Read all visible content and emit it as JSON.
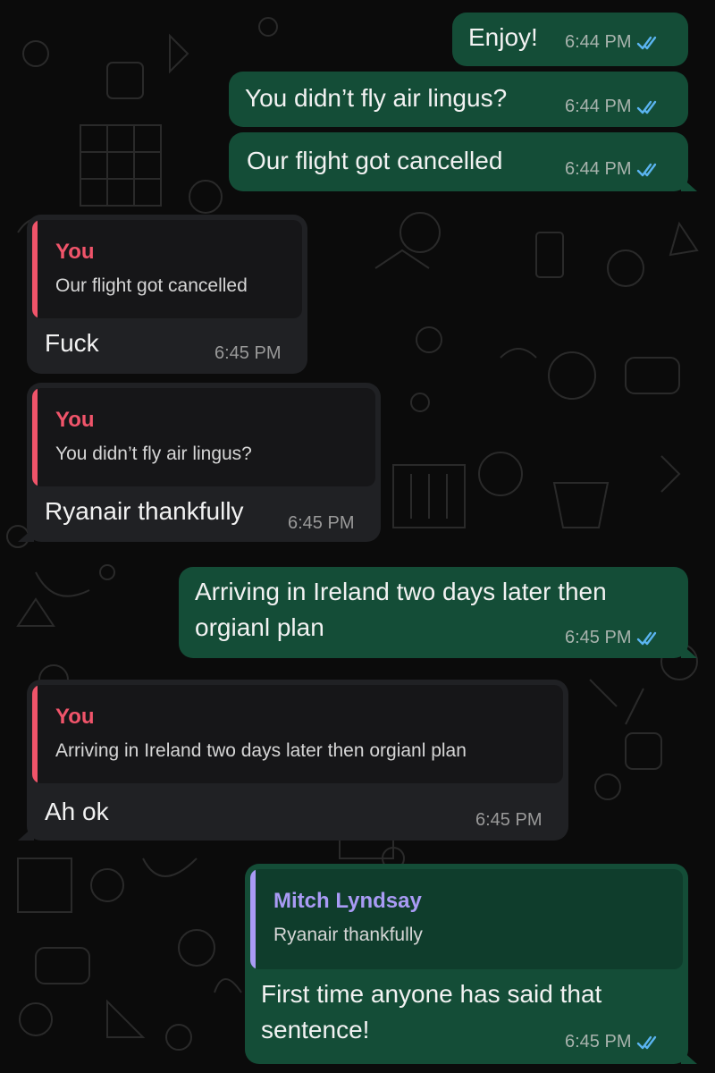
{
  "messages": [
    {
      "dir": "out",
      "text": "Enjoy!",
      "time": "6:44 PM",
      "read": true
    },
    {
      "dir": "out",
      "text": "You didn’t fly air lingus?",
      "time": "6:44 PM",
      "read": true
    },
    {
      "dir": "out",
      "text": "Our flight got cancelled",
      "time": "6:44 PM",
      "read": true
    },
    {
      "dir": "in",
      "reply": {
        "author": "You",
        "text": "Our flight got cancelled"
      },
      "text": "Fuck",
      "time": "6:45 PM"
    },
    {
      "dir": "in",
      "reply": {
        "author": "You",
        "text": "You didn’t fly air lingus?"
      },
      "text": "Ryanair thankfully",
      "time": "6:45 PM"
    },
    {
      "dir": "out",
      "text": "Arriving in Ireland two days later then\norgianl plan",
      "time": "6:45 PM",
      "read": true
    },
    {
      "dir": "in",
      "reply": {
        "author": "You",
        "text": "Arriving in Ireland two days later then orgianl plan"
      },
      "text": "Ah ok",
      "time": "6:45 PM"
    },
    {
      "dir": "out",
      "reply": {
        "author": "Mitch Lyndsay",
        "text": "Ryanair thankfully"
      },
      "text": "First time anyone has said that\nsentence!",
      "time": "6:45 PM",
      "read": true
    }
  ],
  "colors": {
    "outgoing_bubble": "#144d37",
    "incoming_bubble": "#202124",
    "read_check": "#5ab4f0",
    "reply_author_self": "#f0546a",
    "reply_author_other": "#a99bf5"
  },
  "icons": {
    "read_receipt": "double-check-icon"
  }
}
